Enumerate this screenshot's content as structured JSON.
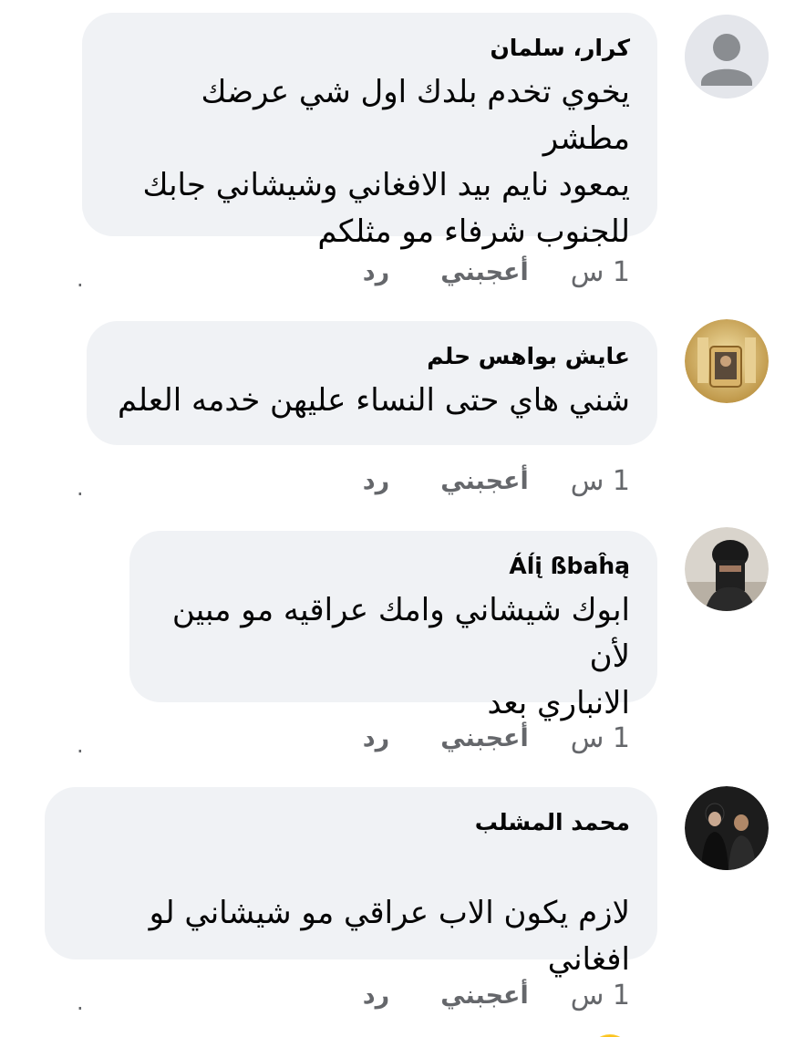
{
  "comments": [
    {
      "author": "كرار، سلمان",
      "text": "يخوي تخدم بلدك اول شي عرضك مطشر\nيمعود نايم بيد الافغاني وشيشاني  جابك\nللجنوب شرفاء مو مثلكم",
      "avatar": "default-person",
      "time": "1 س",
      "like": "أعجبني",
      "reply": "رد",
      "dot": "."
    },
    {
      "author": "عايش بواهس حلم",
      "text": "شني هاي حتى النساء عليهن خدمه العلم",
      "avatar": "shrine-photo",
      "time": "1 س",
      "like": "أعجبني",
      "reply": "رد",
      "dot": "."
    },
    {
      "author": "Áĺį ßbaĥą",
      "text": "ابوك شيشاني وامك عراقيه مو مبين لأن\nالانباري بعد",
      "avatar": "masked-person-photo",
      "time": "1 س",
      "like": "أعجبني",
      "reply": "رد",
      "dot": "."
    },
    {
      "author": "محمد المشلب",
      "text": "لازم يكون الاب عراقي مو شيشاني لو افغاني",
      "emoji": "winking-face-with-tongue",
      "avatar": "two-men-photo",
      "time": "1 س",
      "like": "أعجبني",
      "reply": "رد",
      "dot": "."
    }
  ],
  "colors": {
    "bubble": "#f0f2f5",
    "meta_text": "#65676b",
    "text": "#050505"
  }
}
